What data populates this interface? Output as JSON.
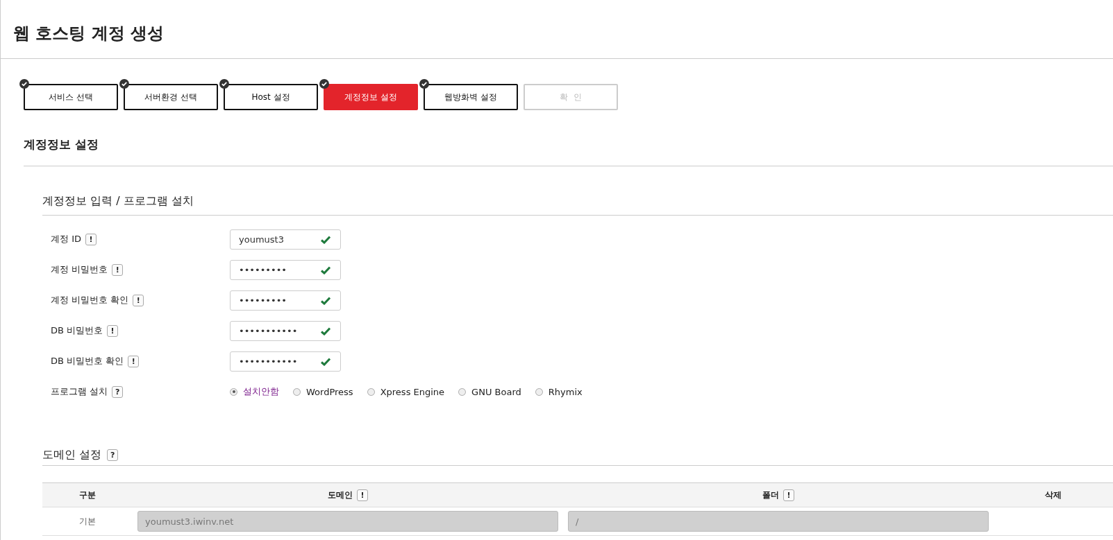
{
  "page_title": "웹 호스팅 계정 생성",
  "steps": [
    {
      "label": "서비스 선택",
      "checked": true,
      "selected": false,
      "disabled": false
    },
    {
      "label": "서버환경 선택",
      "checked": true,
      "selected": false,
      "disabled": false
    },
    {
      "label": "Host 설정",
      "checked": true,
      "selected": false,
      "disabled": false
    },
    {
      "label": "계정정보 설정",
      "checked": true,
      "selected": true,
      "disabled": false
    },
    {
      "label": "웹방화벽 설정",
      "checked": true,
      "selected": false,
      "disabled": false
    },
    {
      "label": "확  인",
      "checked": false,
      "selected": false,
      "disabled": true
    }
  ],
  "section_title": "계정정보 설정",
  "account_section": {
    "title": "계정정보 입력 / 프로그램 설치",
    "fields": [
      {
        "label": "계정 ID",
        "hint": "!",
        "value": "youmust3",
        "valid": true
      },
      {
        "label": "계정 비밀번호",
        "hint": "!",
        "value": "•••••••••",
        "valid": true
      },
      {
        "label": "계정 비밀번호 확인",
        "hint": "!",
        "value": "•••••••••",
        "valid": true
      },
      {
        "label": "DB 비밀번호",
        "hint": "!",
        "value": "•••••••••••",
        "valid": true
      },
      {
        "label": "DB 비밀번호 확인",
        "hint": "!",
        "value": "•••••••••••",
        "valid": true
      }
    ],
    "program": {
      "label": "프로그램 설치",
      "hint": "?",
      "options": [
        {
          "label": "설치안함",
          "selected": true
        },
        {
          "label": "WordPress",
          "selected": false
        },
        {
          "label": "Xpress Engine",
          "selected": false
        },
        {
          "label": "GNU Board",
          "selected": false
        },
        {
          "label": "Rhymix",
          "selected": false
        }
      ]
    }
  },
  "domain_section": {
    "title": "도메인 설정",
    "hint": "?",
    "table": {
      "columns": [
        {
          "label": "구분"
        },
        {
          "label": "도메인",
          "hint": "!"
        },
        {
          "label": "폴더",
          "hint": "!"
        },
        {
          "label": "삭제"
        }
      ],
      "rows": [
        {
          "type": "기본",
          "domain": "youmust3.iwinv.net",
          "folder": "/"
        }
      ]
    }
  }
}
